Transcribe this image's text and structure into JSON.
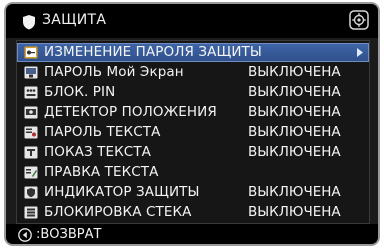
{
  "title": "ЗАЩИТА",
  "icons": {
    "title": "shield-icon",
    "move": "move-icon",
    "back": "left-arrow-icon"
  },
  "colors": {
    "selection": "#3a5c9c",
    "background": "#1b1b1b",
    "text": "#f4f4f4"
  },
  "menu": {
    "items": [
      {
        "label": "ИЗМЕНЕНИЕ ПАРОЛЯ ЗАЩИТЫ",
        "value": "",
        "icon": "key-icon",
        "selected": true
      },
      {
        "label": "ПАРОЛЬ Мой Экран",
        "value": "ВЫКЛЮЧЕНА",
        "icon": "screen-lock-icon"
      },
      {
        "label": "БЛОК. PIN",
        "value": "ВЫКЛЮЧЕНА",
        "icon": "pin-icon"
      },
      {
        "label": "ДЕТЕКТОР ПОЛОЖЕНИЯ",
        "value": "ВЫКЛЮЧЕНА",
        "icon": "detector-icon"
      },
      {
        "label": "ПАРОЛЬ ТЕКСТА",
        "value": "ВЫКЛЮЧЕНА",
        "icon": "text-password-icon"
      },
      {
        "label": "ПОКАЗ ТЕКСТА",
        "value": "ВЫКЛЮЧЕНА",
        "icon": "text-display-icon"
      },
      {
        "label": "ПРАВКА ТЕКСТА",
        "value": "",
        "icon": "text-edit-icon"
      },
      {
        "label": "ИНДИКАТОР ЗАЩИТЫ",
        "value": "ВЫКЛЮЧЕНА",
        "icon": "security-indicator-icon"
      },
      {
        "label": "БЛОКИРОВКА СТЕКА",
        "value": "ВЫКЛЮЧЕНА",
        "icon": "stack-lock-icon"
      }
    ]
  },
  "footer": {
    "back_label": ":ВОЗВРАТ"
  }
}
